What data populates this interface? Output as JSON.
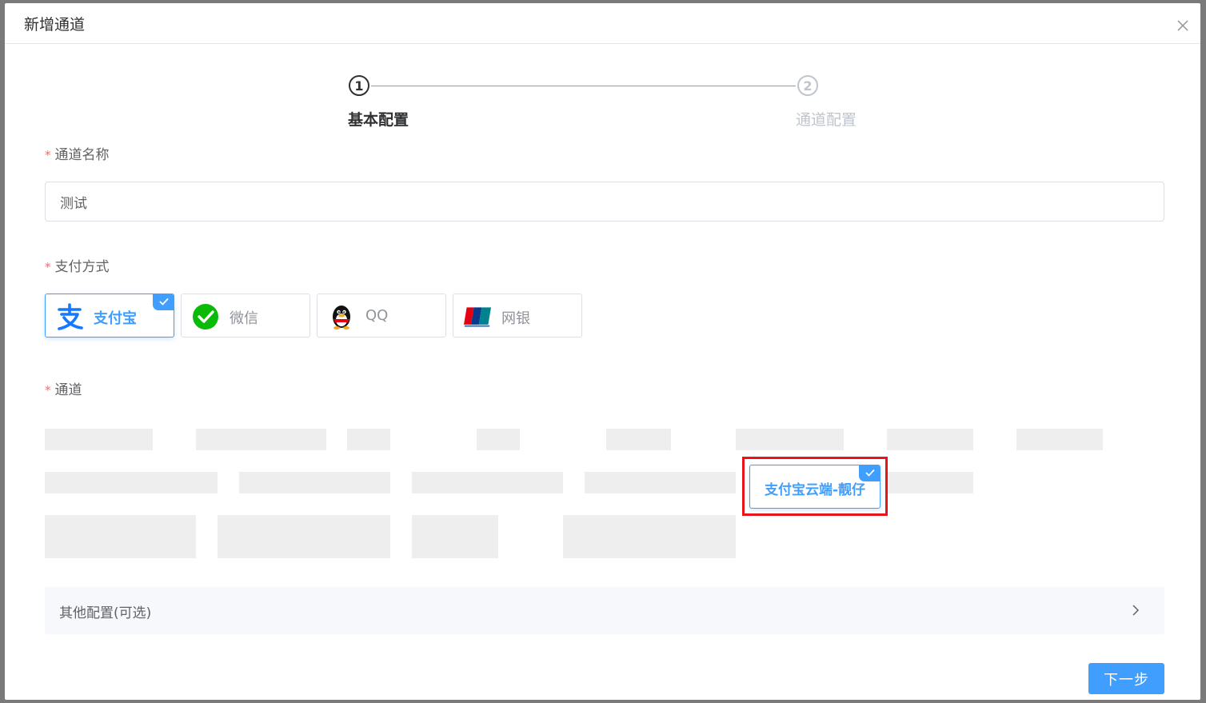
{
  "modal": {
    "title": "新增通道"
  },
  "steps": [
    {
      "number": "1",
      "label": "基本配置",
      "active": true
    },
    {
      "number": "2",
      "label": "通道配置",
      "active": false
    }
  ],
  "form": {
    "name": {
      "required_mark": "*",
      "label": "通道名称",
      "value": "测试"
    },
    "payment": {
      "required_mark": "*",
      "label": "支付方式",
      "options": [
        {
          "label": "支付宝",
          "icon": "alipay-icon",
          "selected": true
        },
        {
          "label": "微信",
          "icon": "wechat-icon",
          "selected": false
        },
        {
          "label": "QQ",
          "icon": "qq-penguin-icon",
          "selected": false
        },
        {
          "label": "网银",
          "icon": "unionpay-icon",
          "selected": false
        }
      ]
    },
    "channel": {
      "required_mark": "*",
      "label": "通道",
      "selected_option": "支付宝云端-靓仔"
    }
  },
  "other_config": {
    "label": "其他配置(可选)"
  },
  "next_button": {
    "label": "下一步"
  },
  "colors": {
    "primary": "#409eff",
    "required": "#f56c6c",
    "highlight": "#e8141a",
    "alipay": "#1677ff",
    "wechat": "#09bb07",
    "unionpay_red": "#e60012"
  }
}
